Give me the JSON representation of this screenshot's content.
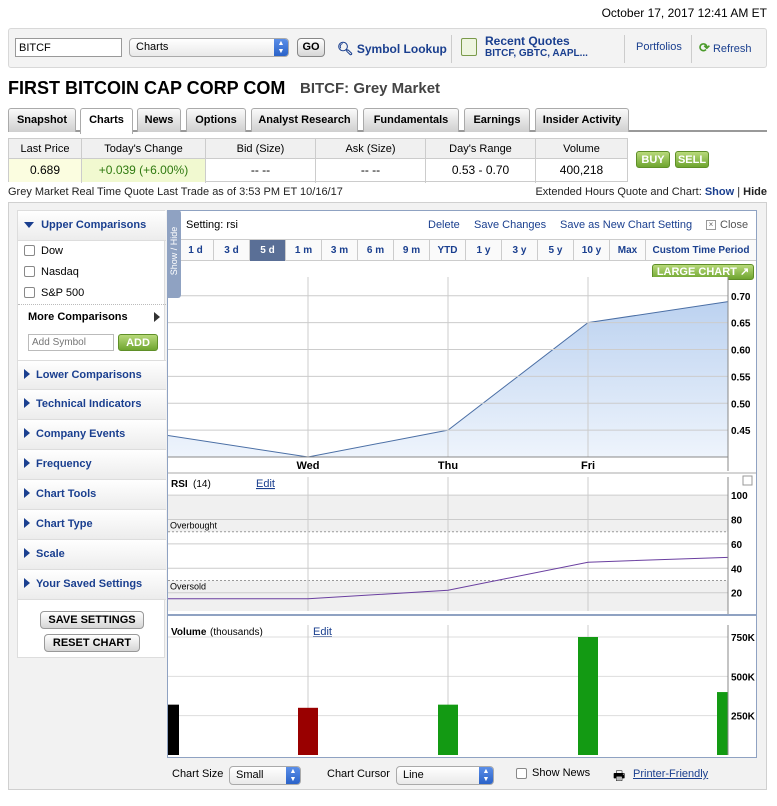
{
  "datetime": "October 17, 2017 12:41 AM ET",
  "topbar": {
    "symbol_value": "BITCF",
    "view_select": "Charts",
    "go_label": "GO",
    "symbol_lookup": "Symbol Lookup",
    "recent_quotes_title": "Recent Quotes",
    "recent_quotes_list": "BITCF, GBTC, AAPL...",
    "portfolios": "Portfolios",
    "refresh": "Refresh"
  },
  "company": {
    "name": "FIRST BITCOIN CAP CORP COM",
    "ticker_market": "BITCF: Grey Market"
  },
  "tabs": [
    "Snapshot",
    "Charts",
    "News",
    "Options",
    "Analyst Research",
    "Fundamentals",
    "Earnings",
    "Insider Activity"
  ],
  "quote": {
    "headers": [
      "Last Price",
      "Today's Change",
      "Bid (Size)",
      "Ask (Size)",
      "Day's Range",
      "Volume"
    ],
    "values": [
      "0.689",
      "+0.039 (+6.00%)",
      "-- --",
      "-- --",
      "0.53 - 0.70",
      "400,218"
    ],
    "buy": "BUY",
    "sell": "SELL"
  },
  "info": {
    "left": "Grey Market Real Time Quote  Last Trade as of 3:53 PM ET 10/16/17",
    "right_prefix": "Extended Hours Quote and Chart:",
    "show": "Show",
    "sep": "|",
    "hide": "Hide"
  },
  "sidebar": {
    "upper_comparisons": "Upper Comparisons",
    "checkboxes": [
      "Dow",
      "Nasdaq",
      "S&P 500"
    ],
    "more_comparisons": "More Comparisons",
    "add_symbol_placeholder": "Add Symbol",
    "add_label": "ADD",
    "sections": [
      "Lower Comparisons",
      "Technical Indicators",
      "Company Events",
      "Frequency",
      "Chart Tools",
      "Chart Type",
      "Scale",
      "Your Saved Settings"
    ],
    "save_settings": "SAVE SETTINGS",
    "reset_chart": "RESET CHART",
    "show_hide": "Show / Hide"
  },
  "chartbar": {
    "setting_label": "Setting:",
    "setting_value": "rsi",
    "delete": "Delete",
    "save_changes": "Save Changes",
    "save_new": "Save as New Chart Setting",
    "close": "Close",
    "periods": [
      "1 d",
      "3 d",
      "5 d",
      "1 m",
      "3 m",
      "6 m",
      "9 m",
      "YTD",
      "1 y",
      "3 y",
      "5 y",
      "10 y",
      "Max",
      "Custom Time Period"
    ],
    "active_period": "5 d",
    "large_chart": "LARGE CHART"
  },
  "colors": {
    "accent": "#1a3f8f",
    "area_fill": "#bcd2f0",
    "rsi_line": "#6a3fa0",
    "vol_black": "#000000",
    "vol_red": "#990000",
    "vol_green": "#139a13"
  },
  "chart_data": [
    {
      "type": "area",
      "x": [
        "Mon",
        "Wed",
        "Thu",
        "Fri",
        "end"
      ],
      "x_tick_labels": [
        "Wed",
        "Thu",
        "Fri"
      ],
      "values": [
        0.44,
        0.4,
        0.45,
        0.65,
        0.689
      ],
      "ylim": [
        0.4,
        0.72
      ],
      "yticks": [
        "0.70",
        "0.65",
        "0.60",
        "0.55",
        "0.50",
        "0.45"
      ],
      "grid": true
    },
    {
      "type": "line",
      "title": "RSI",
      "period_label": "(14)",
      "edit": "Edit",
      "x": [
        "Mon",
        "Wed",
        "Thu",
        "Fri",
        "end"
      ],
      "values": [
        15,
        15,
        22,
        45,
        49
      ],
      "ylim": [
        5,
        105
      ],
      "yticks": [
        "100",
        "80",
        "60",
        "40",
        "20"
      ],
      "overbought_label": "Overbought",
      "oversold_label": "Oversold",
      "overbought": 70,
      "oversold": 30
    },
    {
      "type": "bar",
      "title": "Volume",
      "unit_label": "(thousands)",
      "edit": "Edit",
      "x": [
        "Mon",
        "Wed",
        "Thu",
        "Fri",
        "end"
      ],
      "values": [
        320,
        300,
        320,
        750,
        400
      ],
      "bar_colors": [
        "black",
        "red",
        "green",
        "green",
        "green"
      ],
      "ylim": [
        0,
        750
      ],
      "yticks": [
        "750K",
        "500K",
        "250K"
      ]
    }
  ],
  "bottombar": {
    "chart_size_label": "Chart Size",
    "chart_size_value": "Small",
    "chart_cursor_label": "Chart Cursor",
    "chart_cursor_value": "Line",
    "show_news": "Show News",
    "printer_friendly": "Printer-Friendly"
  }
}
